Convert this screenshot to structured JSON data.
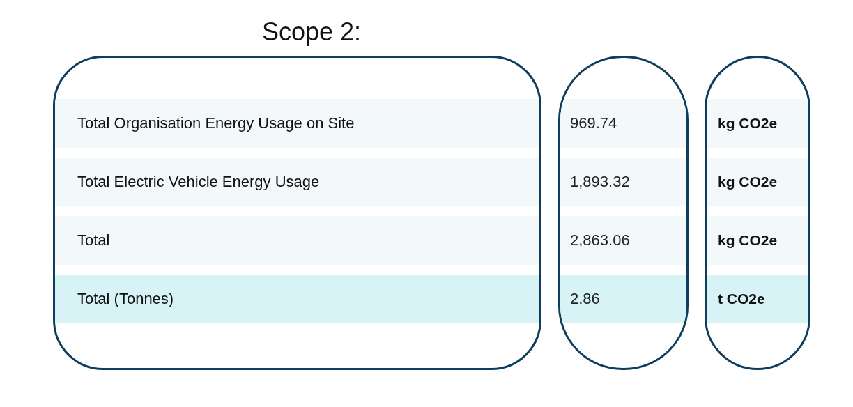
{
  "title": "Scope 2:",
  "rows": [
    {
      "label": "Total Organisation Energy Usage on Site",
      "value": "969.74",
      "unit": "kg CO2e",
      "highlighted": false
    },
    {
      "label": "Total Electric Vehicle Energy Usage",
      "value": "1,893.32",
      "unit": "kg CO2e",
      "highlighted": false
    },
    {
      "label": "Total",
      "value": "2,863.06",
      "unit": "kg CO2e",
      "highlighted": false
    },
    {
      "label": "Total (Tonnes)",
      "value": "2.86",
      "unit": "t CO2e",
      "highlighted": true
    }
  ]
}
